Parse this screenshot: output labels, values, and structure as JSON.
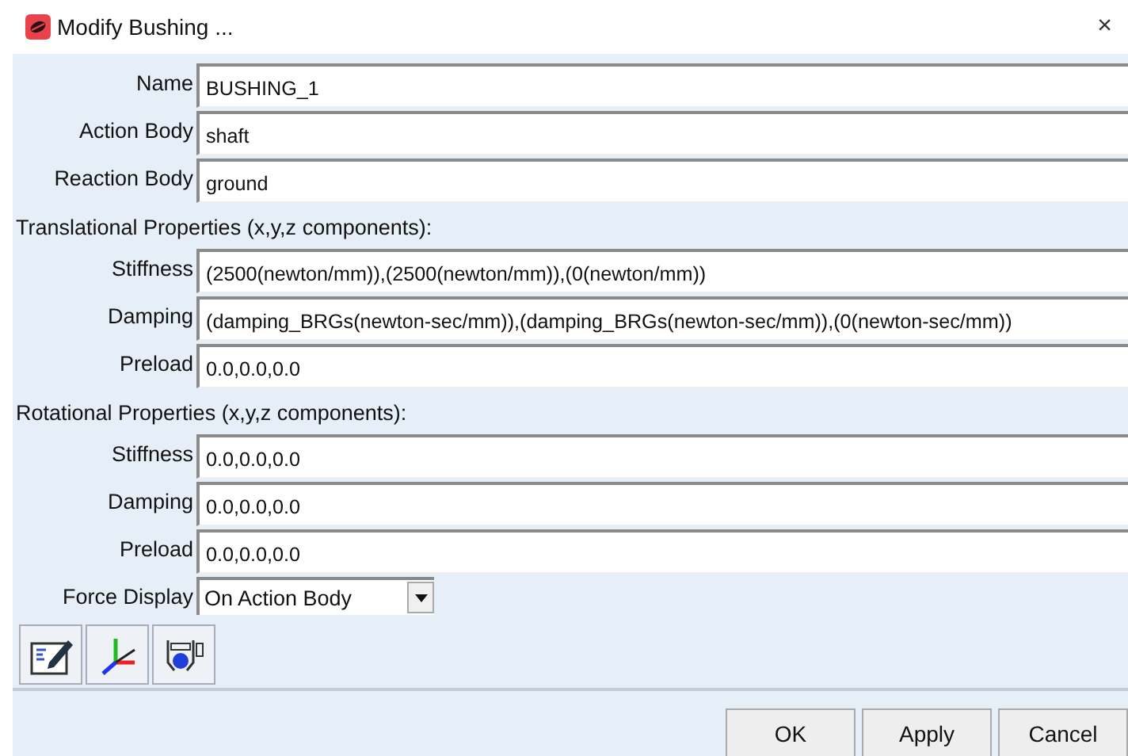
{
  "window": {
    "title": "Modify Bushing ...",
    "close": "×"
  },
  "general": [
    {
      "label": "Name",
      "value": "BUSHING_1"
    },
    {
      "label": "Action Body",
      "value": "shaft"
    },
    {
      "label": "Reaction Body",
      "value": "ground"
    }
  ],
  "sections": [
    {
      "heading": "Translational Properties (x,y,z components):",
      "fields": [
        {
          "label": "Stiffness",
          "value": "(2500(newton/mm)),(2500(newton/mm)),(0(newton/mm))"
        },
        {
          "label": "Damping",
          "value": "(damping_BRGs(newton-sec/mm)),(damping_BRGs(newton-sec/mm)),(0(newton-sec/mm))"
        },
        {
          "label": "Preload",
          "value": "0.0,0.0,0.0"
        }
      ]
    },
    {
      "heading": "Rotational Properties (x,y,z components):",
      "fields": [
        {
          "label": "Stiffness",
          "value": "0.0,0.0,0.0"
        },
        {
          "label": "Damping",
          "value": "0.0,0.0,0.0"
        },
        {
          "label": "Preload",
          "value": "0.0,0.0,0.0"
        }
      ]
    }
  ],
  "force_display": {
    "label": "Force Display",
    "value": "On Action Body"
  },
  "buttons": [
    "OK",
    "Apply",
    "Cancel"
  ]
}
